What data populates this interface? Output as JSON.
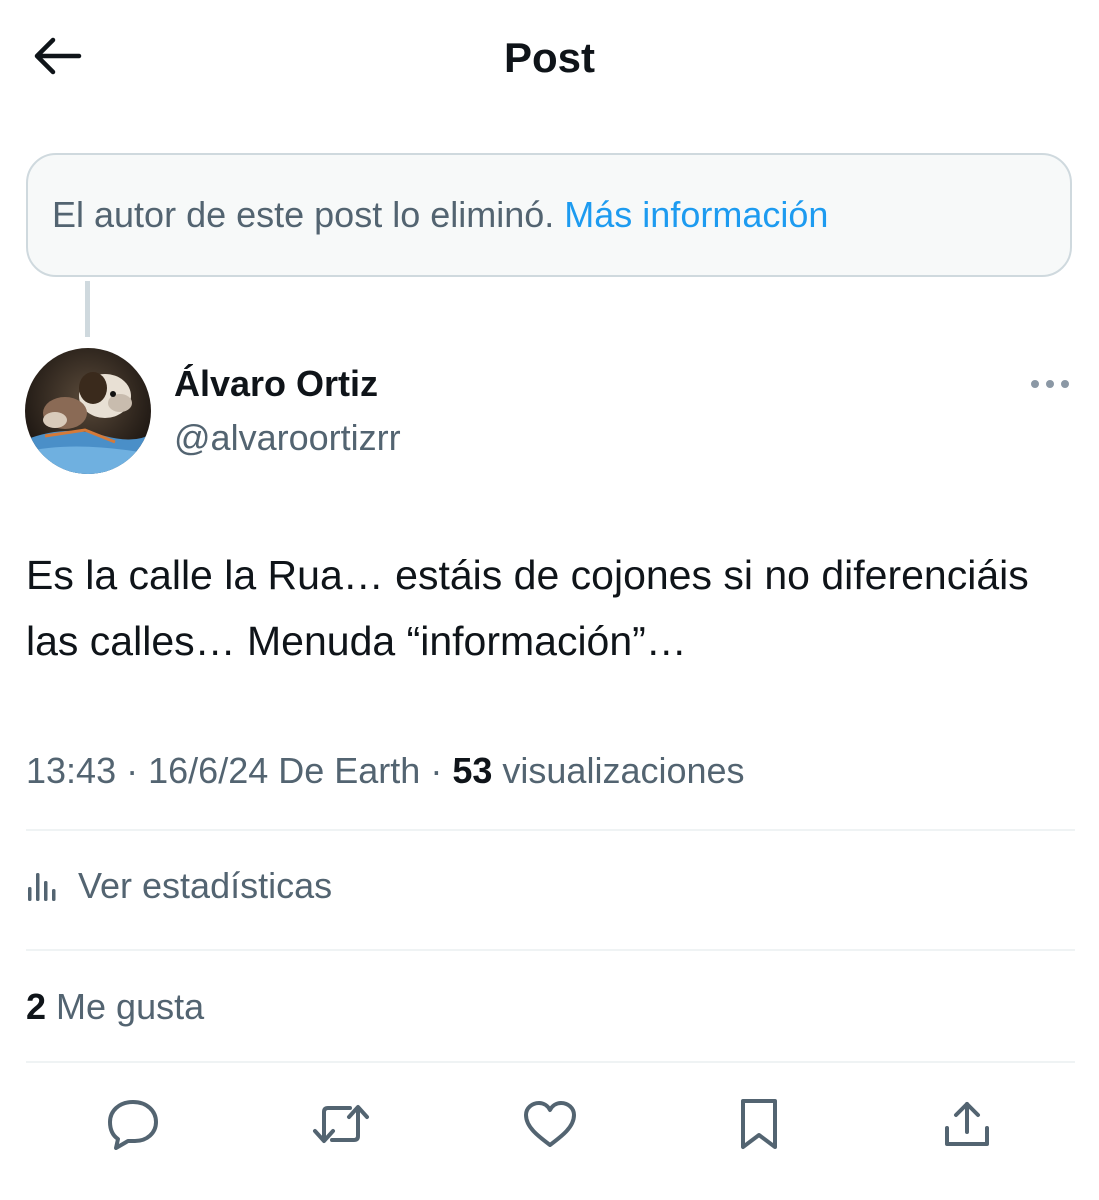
{
  "header": {
    "title": "Post",
    "back_icon": "arrow-left-icon"
  },
  "deleted_notice": {
    "text": "El autor de este post lo eliminó.",
    "link": "Más información",
    "link_color": "#1d9bf0"
  },
  "author": {
    "name": "Álvaro Ortiz",
    "handle": "@alvaroortizrr"
  },
  "post": {
    "text": "Es la calle la Rua… estáis de cojones si no diferenciáis las calles… Menuda “información”…",
    "time": "13:43",
    "separator": "·",
    "date_source": "16/6/24 De Earth",
    "views_count": "53",
    "views_label": "visualizaciones"
  },
  "stats": {
    "label": "Ver estadísticas",
    "icon": "analytics-icon"
  },
  "likes": {
    "count": "2",
    "label": "Me gusta"
  },
  "actions": {
    "icons": [
      "reply-icon",
      "repost-icon",
      "like-icon",
      "bookmark-icon",
      "share-icon"
    ]
  },
  "colors": {
    "text_primary": "#0f1419",
    "text_secondary": "#536471",
    "accent": "#1d9bf0",
    "divider": "#eff3f4"
  }
}
